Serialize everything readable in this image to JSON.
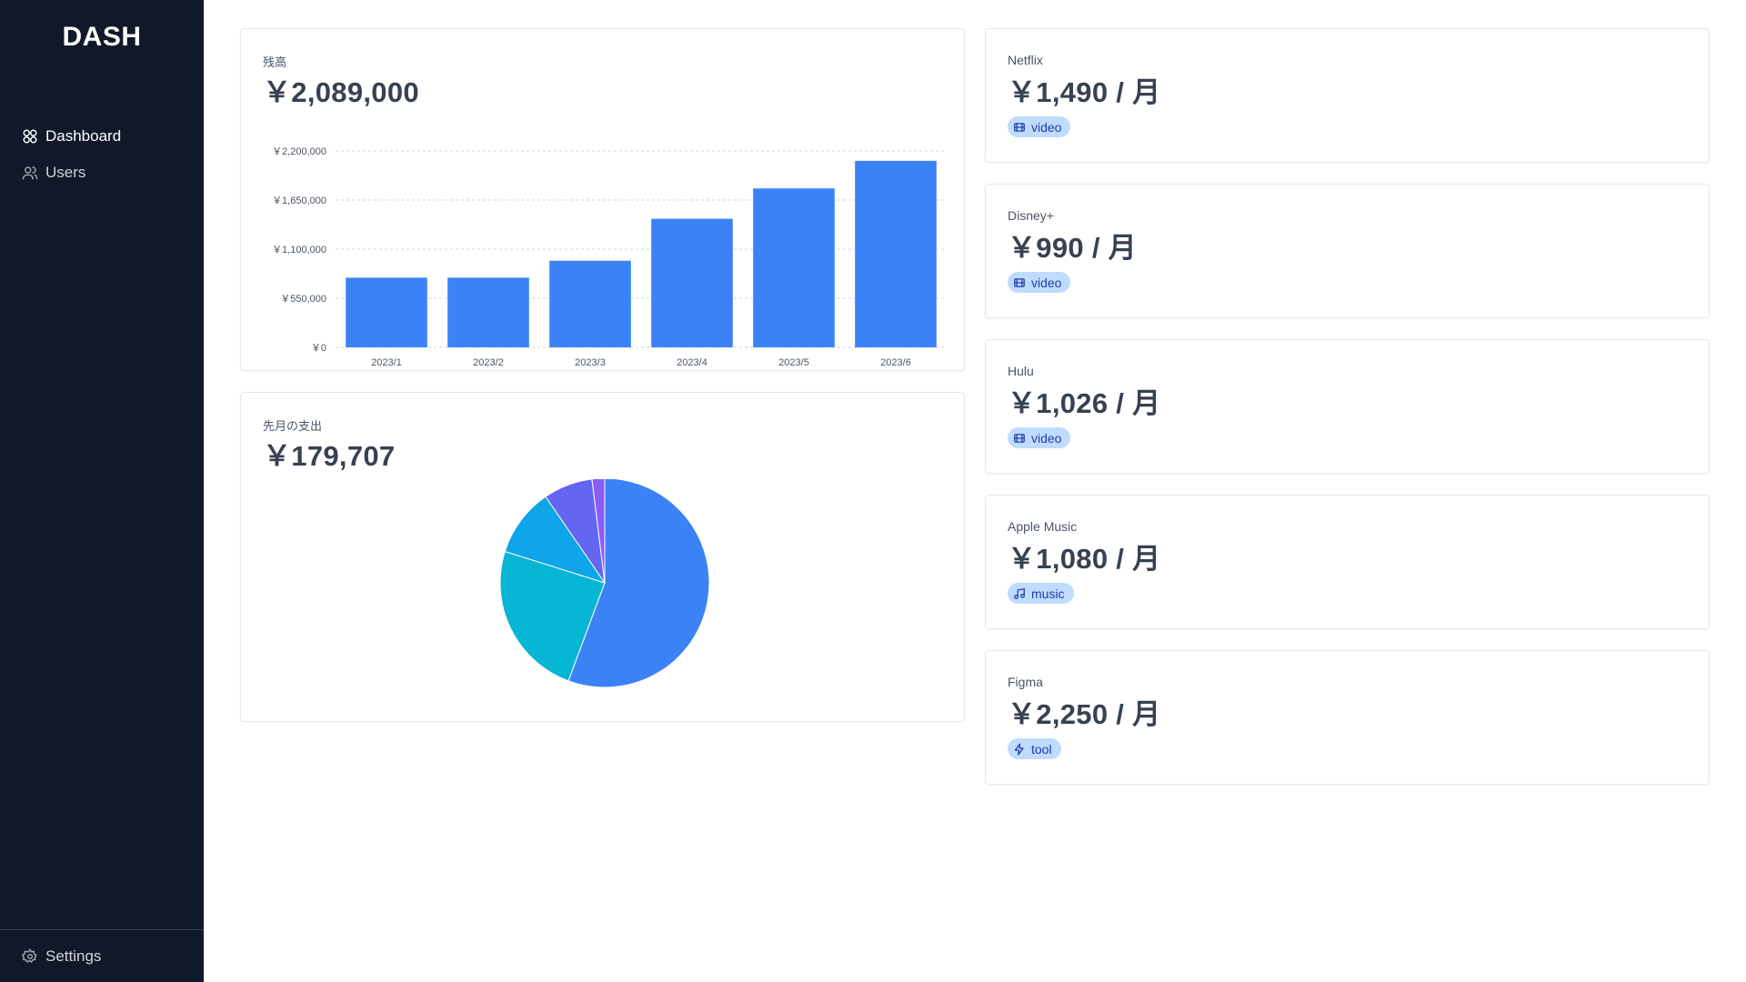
{
  "sidebar": {
    "logo": "DASH",
    "nav": [
      {
        "label": "Dashboard",
        "icon": "grid-icon",
        "active": true
      },
      {
        "label": "Users",
        "icon": "users-icon",
        "active": false
      }
    ],
    "footer": {
      "label": "Settings",
      "icon": "gear-icon"
    }
  },
  "balance": {
    "label": "残高",
    "value": "￥2,089,000"
  },
  "spending": {
    "label": "先月の支出",
    "value": "￥179,707"
  },
  "subscriptions": [
    {
      "name": "Netflix",
      "price": "￥1,490 / 月",
      "tag": "video",
      "tag_icon": "film-icon"
    },
    {
      "name": "Disney+",
      "price": "￥990 / 月",
      "tag": "video",
      "tag_icon": "film-icon"
    },
    {
      "name": "Hulu",
      "price": "￥1,026 / 月",
      "tag": "video",
      "tag_icon": "film-icon"
    },
    {
      "name": "Apple Music",
      "price": "￥1,080 / 月",
      "tag": "music",
      "tag_icon": "music-note-icon"
    },
    {
      "name": "Figma",
      "price": "￥2,250 / 月",
      "tag": "tool",
      "tag_icon": "bolt-icon"
    }
  ],
  "colors": {
    "sidebar_bg": "#111827",
    "bar": "#3b82f6",
    "tag_bg": "#bfdbfe",
    "tag_text": "#1e40af",
    "pie": [
      "#3b82f6",
      "#06b6d4",
      "#0ea5e9",
      "#6366f1",
      "#8b5cf6"
    ]
  },
  "chart_data": [
    {
      "type": "bar",
      "categories": [
        "2023/1",
        "2023/2",
        "2023/3",
        "2023/4",
        "2023/5",
        "2023/6"
      ],
      "values": [
        780000,
        780000,
        970000,
        1440000,
        1780000,
        2089000
      ],
      "ylim": [
        0,
        2200000
      ],
      "yticks": [
        0,
        550000,
        1100000,
        1650000,
        2200000
      ],
      "ytick_labels": [
        "￥0",
        "￥550,000",
        "￥1,100,000",
        "￥1,650,000",
        "￥2,200,000"
      ],
      "grid": true,
      "title": "",
      "xlabel": "",
      "ylabel": ""
    },
    {
      "type": "pie",
      "values": [
        100000,
        43500,
        19000,
        13700,
        3507
      ],
      "colors": [
        "#3b82f6",
        "#06b6d4",
        "#0ea5e9",
        "#6366f1",
        "#8b5cf6"
      ]
    }
  ]
}
